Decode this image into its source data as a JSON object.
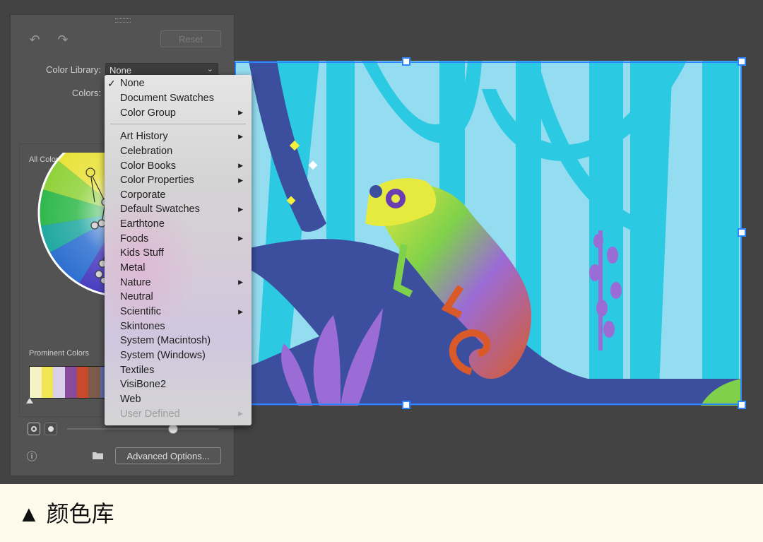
{
  "panel": {
    "reset_label": "Reset",
    "color_library_label": "Color Library:",
    "color_library_value": "None",
    "colors_label": "Colors:",
    "all_colors_label": "All Colors",
    "prominent_colors_label": "Prominent Colors",
    "advanced_options_label": "Advanced Options...",
    "prominent_swatches": [
      "#f5f2c8",
      "#f2e552",
      "#d7d0e8",
      "#8a4a9b",
      "#c94a2b",
      "#7d5a4a",
      "#5b6ea8",
      "#3d4aa0",
      "#7bb0d8",
      "#a98cc6",
      "#5f3c7a",
      "#d8d8d8"
    ]
  },
  "menu": {
    "items": [
      {
        "label": "None",
        "checked": true,
        "submenu": false,
        "disabled": false
      },
      {
        "label": "Document Swatches",
        "checked": false,
        "submenu": false,
        "disabled": false
      },
      {
        "label": "Color Group",
        "checked": false,
        "submenu": true,
        "disabled": false
      },
      {
        "label": "Art History",
        "checked": false,
        "submenu": true,
        "disabled": false
      },
      {
        "label": "Celebration",
        "checked": false,
        "submenu": false,
        "disabled": false
      },
      {
        "label": "Color Books",
        "checked": false,
        "submenu": true,
        "disabled": false
      },
      {
        "label": "Color Properties",
        "checked": false,
        "submenu": true,
        "disabled": false
      },
      {
        "label": "Corporate",
        "checked": false,
        "submenu": false,
        "disabled": false
      },
      {
        "label": "Default Swatches",
        "checked": false,
        "submenu": true,
        "disabled": false
      },
      {
        "label": "Earthtone",
        "checked": false,
        "submenu": false,
        "disabled": false
      },
      {
        "label": "Foods",
        "checked": false,
        "submenu": true,
        "disabled": false
      },
      {
        "label": "Kids Stuff",
        "checked": false,
        "submenu": false,
        "disabled": false
      },
      {
        "label": "Metal",
        "checked": false,
        "submenu": false,
        "disabled": false
      },
      {
        "label": "Nature",
        "checked": false,
        "submenu": true,
        "disabled": false
      },
      {
        "label": "Neutral",
        "checked": false,
        "submenu": false,
        "disabled": false
      },
      {
        "label": "Scientific",
        "checked": false,
        "submenu": true,
        "disabled": false
      },
      {
        "label": "Skintones",
        "checked": false,
        "submenu": false,
        "disabled": false
      },
      {
        "label": "System (Macintosh)",
        "checked": false,
        "submenu": false,
        "disabled": false
      },
      {
        "label": "System (Windows)",
        "checked": false,
        "submenu": false,
        "disabled": false
      },
      {
        "label": "Textiles",
        "checked": false,
        "submenu": false,
        "disabled": false
      },
      {
        "label": "VisiBone2",
        "checked": false,
        "submenu": false,
        "disabled": false
      },
      {
        "label": "Web",
        "checked": false,
        "submenu": false,
        "disabled": false
      },
      {
        "label": "User Defined",
        "checked": false,
        "submenu": true,
        "disabled": true
      }
    ],
    "check_glyph": "✓",
    "arrow_glyph": "▶"
  },
  "caption": "▲ 颜色库",
  "colors": {
    "selection": "#2e86ff",
    "canvas_bg": "#94dcef",
    "tree": "#2bc9e2",
    "branch": "#3c4f9e"
  }
}
